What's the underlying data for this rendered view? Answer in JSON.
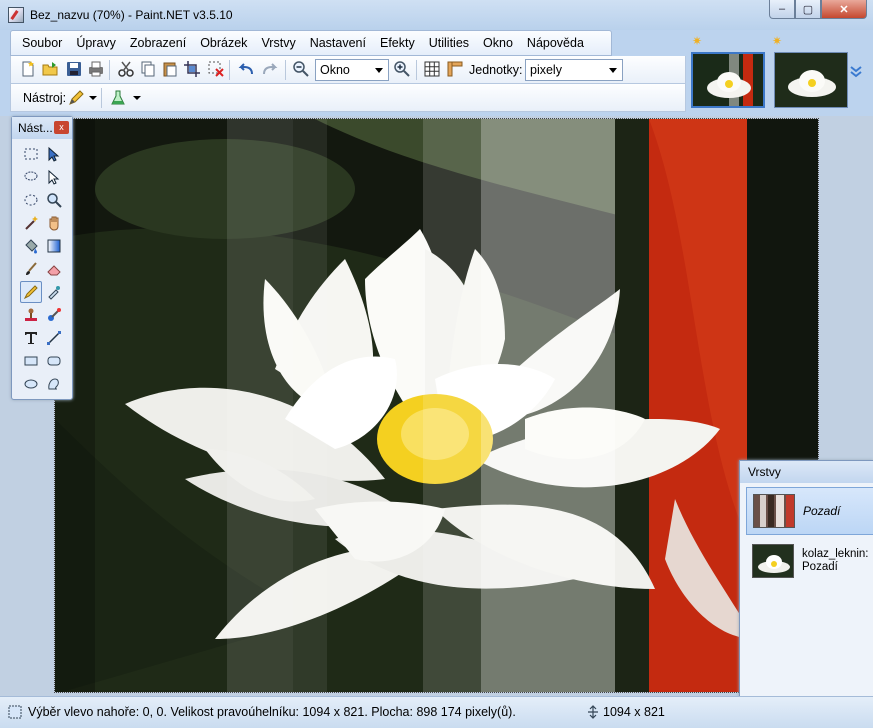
{
  "window": {
    "title": "Bez_nazvu (70%) - Paint.NET v3.5.10",
    "buttons": {
      "minimize": "–",
      "maximize": "▢",
      "close": "✕"
    }
  },
  "menu": [
    "Soubor",
    "Úpravy",
    "Zobrazení",
    "Obrázek",
    "Vrstvy",
    "Nastavení",
    "Efekty",
    "Utilities",
    "Okno",
    "Nápověda"
  ],
  "toolbar": {
    "zoom_value": "Okno",
    "units_label": "Jednotky:",
    "units_value": "pixely",
    "tool_label": "Nástroj:"
  },
  "tools_window": {
    "title": "Nást...",
    "close": "x",
    "tools": [
      "rectangle-select-icon",
      "move-selection-icon",
      "lasso-select-icon",
      "move-selected-icon",
      "ellipse-select-icon",
      "zoom-icon",
      "magic-wand-icon",
      "pan-icon",
      "paint-bucket-icon",
      "gradient-icon",
      "paintbrush-icon",
      "eraser-icon",
      "pencil-icon",
      "color-picker-icon",
      "clone-stamp-icon",
      "recolor-icon",
      "text-icon",
      "line-curve-icon",
      "rectangle-icon",
      "rounded-rectangle-icon",
      "ellipse-icon",
      "freeform-shape-icon"
    ],
    "selected_tool": "pencil-icon"
  },
  "layers_window": {
    "title": "Vrstvy",
    "layers": [
      {
        "name": "Pozadí",
        "selected": true
      },
      {
        "name": "kolaz_leknin: Pozadí",
        "selected": false
      }
    ]
  },
  "status": {
    "text": "Výběr vlevo nahoře: 0, 0. Velikost pravoúhelníku: 1094 x 821. Plocha: 898 174 pixely(ů).",
    "image_size": "1094 x 821"
  },
  "colors": {
    "accent": "#3c78c8",
    "red_strip": "#c42a10",
    "flower_center": "#f4d020"
  }
}
